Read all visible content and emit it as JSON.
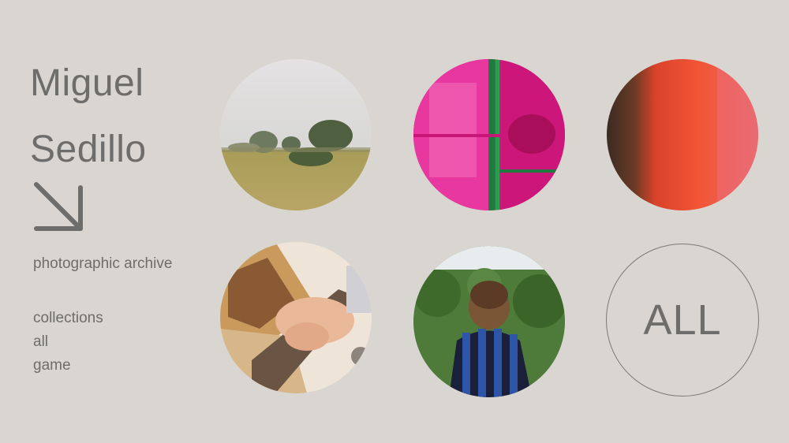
{
  "header": {
    "name_line1": "Miguel",
    "name_line2": "Sedillo"
  },
  "tagline": "photographic archive",
  "nav": {
    "items": [
      "collections",
      "all",
      "game"
    ]
  },
  "gallery": {
    "all_label": "ALL"
  },
  "icons": {
    "arrow": "arrow-down-right-icon"
  },
  "colors": {
    "background": "#d9d5d0",
    "text": "#6d6d6b"
  }
}
